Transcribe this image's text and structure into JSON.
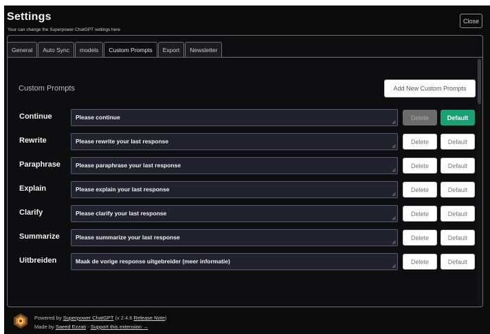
{
  "header": {
    "title": "Settings",
    "subtitle": "Your can change the Superpower ChatGPT settings here",
    "close_label": "Close"
  },
  "tabs": [
    {
      "label": "General",
      "active": false
    },
    {
      "label": "Auto Sync",
      "active": false
    },
    {
      "label": "models",
      "active": false
    },
    {
      "label": "Custom Prompts",
      "active": true
    },
    {
      "label": "Export",
      "active": false
    },
    {
      "label": "Newsletter",
      "active": false
    }
  ],
  "custom_prompts": {
    "section_title": "Custom Prompts",
    "add_button_label": "Add New Custom Prompts",
    "delete_label": "Delete",
    "default_label": "Default",
    "rows": [
      {
        "name": "Continue",
        "text": "Please continue",
        "delete_disabled": true,
        "is_default": true
      },
      {
        "name": "Rewrite",
        "text": "Please rewrite your last response",
        "delete_disabled": false,
        "is_default": false
      },
      {
        "name": "Paraphrase",
        "text": "Please paraphrase your last response",
        "delete_disabled": false,
        "is_default": false
      },
      {
        "name": "Explain",
        "text": "Please explain your last response",
        "delete_disabled": false,
        "is_default": false
      },
      {
        "name": "Clarify",
        "text": "Please clarify your last response",
        "delete_disabled": false,
        "is_default": false
      },
      {
        "name": "Summarize",
        "text": "Please summarize your last response",
        "delete_disabled": false,
        "is_default": false
      },
      {
        "name": "Uitbreiden",
        "text": "Maak de vorige response uitgebreider (meer informatie)",
        "delete_disabled": false,
        "is_default": false
      }
    ]
  },
  "footer": {
    "powered_prefix": "Powered by ",
    "product_link": "Superpower ChatGPT",
    "version": " (v 2.4.6 ",
    "release_note_link": "Release Note",
    "version_suffix": ")",
    "made_by_prefix": "Made by ",
    "author_link": "Saeed Ezzati",
    "separator": " - ",
    "support_link": "Support this extension →"
  },
  "colors": {
    "background": "#0b0b0c",
    "accent_green": "#19a073",
    "input_bg": "#22222e"
  },
  "icons": {
    "logo": "superpower-logo-icon",
    "resize": "resize-handle-icon"
  }
}
